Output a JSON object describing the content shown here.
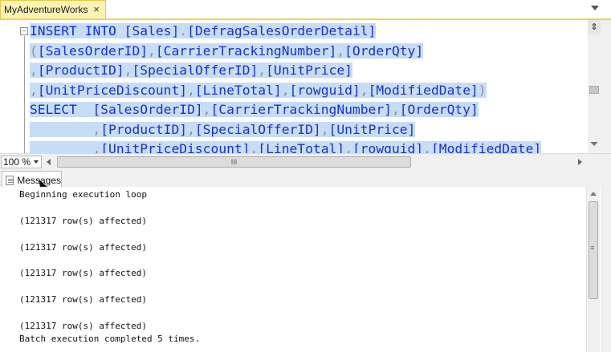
{
  "tab": {
    "title": "MyAdventureWorks",
    "close_glyph": "×"
  },
  "editor": {
    "lines": [
      [
        {
          "t": "INSERT",
          "c": "kw"
        },
        {
          "t": " ",
          "c": ""
        },
        {
          "t": "INTO",
          "c": "kw"
        },
        {
          "t": " ",
          "c": ""
        },
        {
          "t": "[Sales]",
          "c": "id"
        },
        {
          "t": ".",
          "c": "pu"
        },
        {
          "t": "[DefragSalesOrderDetail]",
          "c": "id"
        }
      ],
      [
        {
          "t": "(",
          "c": "pu"
        },
        {
          "t": "[SalesOrderID]",
          "c": "id"
        },
        {
          "t": ",",
          "c": "pu"
        },
        {
          "t": "[CarrierTrackingNumber]",
          "c": "id"
        },
        {
          "t": ",",
          "c": "pu"
        },
        {
          "t": "[OrderQty]",
          "c": "id"
        }
      ],
      [
        {
          "t": ",",
          "c": "pu"
        },
        {
          "t": "[ProductID]",
          "c": "id"
        },
        {
          "t": ",",
          "c": "pu"
        },
        {
          "t": "[SpecialOfferID]",
          "c": "id"
        },
        {
          "t": ",",
          "c": "pu"
        },
        {
          "t": "[UnitPrice]",
          "c": "id"
        }
      ],
      [
        {
          "t": ",",
          "c": "pu"
        },
        {
          "t": "[UnitPriceDiscount]",
          "c": "id"
        },
        {
          "t": ",",
          "c": "pu"
        },
        {
          "t": "[LineTotal]",
          "c": "id"
        },
        {
          "t": ",",
          "c": "pu"
        },
        {
          "t": "[rowguid]",
          "c": "id"
        },
        {
          "t": ",",
          "c": "pu"
        },
        {
          "t": "[ModifiedDate]",
          "c": "id"
        },
        {
          "t": ")",
          "c": "pu"
        }
      ],
      [
        {
          "t": "SELECT",
          "c": "kw"
        },
        {
          "t": "  ",
          "c": ""
        },
        {
          "t": "[SalesOrderID]",
          "c": "id"
        },
        {
          "t": ",",
          "c": "pu"
        },
        {
          "t": "[CarrierTrackingNumber]",
          "c": "id"
        },
        {
          "t": ",",
          "c": "pu"
        },
        {
          "t": "[OrderQty]",
          "c": "id"
        }
      ],
      [
        {
          "t": "        ",
          "c": ""
        },
        {
          "t": ",",
          "c": "pu"
        },
        {
          "t": "[ProductID]",
          "c": "id"
        },
        {
          "t": ",",
          "c": "pu"
        },
        {
          "t": "[SpecialOfferID]",
          "c": "id"
        },
        {
          "t": ",",
          "c": "pu"
        },
        {
          "t": "[UnitPrice]",
          "c": "id"
        }
      ],
      [
        {
          "t": "        ",
          "c": ""
        },
        {
          "t": ",",
          "c": "pu"
        },
        {
          "t": "[UnitPriceDiscount]",
          "c": "id"
        },
        {
          "t": ",",
          "c": "pu"
        },
        {
          "t": "[LineTotal]",
          "c": "id"
        },
        {
          "t": ",",
          "c": "pu"
        },
        {
          "t": "[rowguid]",
          "c": "id"
        },
        {
          "t": ",",
          "c": "pu"
        },
        {
          "t": "[ModifiedDate]",
          "c": "id"
        }
      ]
    ],
    "colors": {
      "keyword": "#0a2ee6",
      "identifier": "#1a33c8",
      "punctuation": "#8c8c8c",
      "selection": "#c7dcf6"
    }
  },
  "statusbar": {
    "zoom": "100 %",
    "hscroll_grip": "III"
  },
  "results": {
    "tab_label": "Messages",
    "messages": [
      "Beginning execution loop",
      "",
      "(121317 row(s) affected)",
      "",
      "(121317 row(s) affected)",
      "",
      "(121317 row(s) affected)",
      "",
      "(121317 row(s) affected)",
      "",
      "(121317 row(s) affected)",
      "Batch execution completed 5 times."
    ]
  },
  "icons": {
    "tab_close": "close-icon",
    "tab_overflow": "chevron-down-icon",
    "split": "split-window-icon",
    "messages": "messages-icon"
  }
}
